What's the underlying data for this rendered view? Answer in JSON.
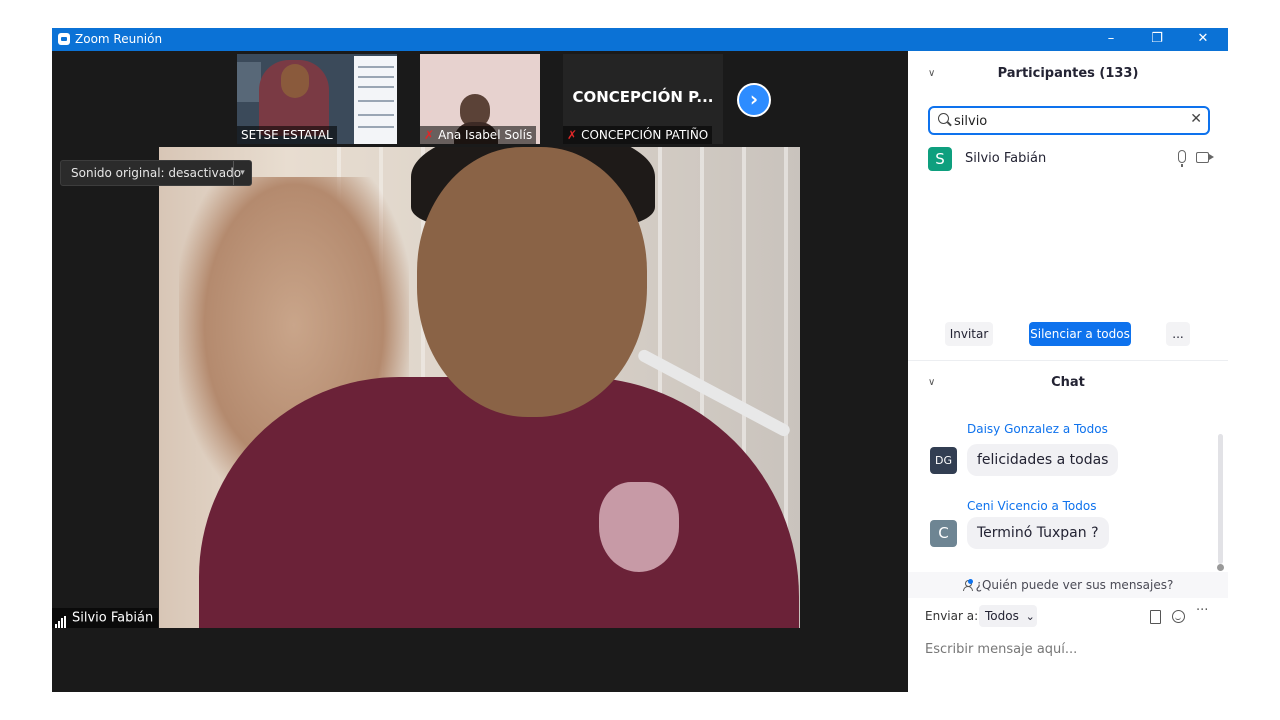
{
  "window": {
    "title": "Zoom Reunión",
    "minimize": "–",
    "restore": "❐",
    "close": "✕"
  },
  "thumbnails": [
    {
      "label": "SETSE ESTATAL",
      "muted": false
    },
    {
      "label": "Ana  Isabel Solís",
      "muted": true
    },
    {
      "label": "CONCEPCIÓN PATIÑO",
      "muted": true,
      "display_name": "CONCEPCIÓN  P..."
    }
  ],
  "next_arrow": "›",
  "audio_pill": {
    "label": "Sonido original: desactivado",
    "caret": "▾"
  },
  "speaker": {
    "name": "Silvio Fabián"
  },
  "participants": {
    "collapse": "∨",
    "title": "Participantes (133)",
    "search_value": "silvio",
    "clear": "✕",
    "items": [
      {
        "initial": "S",
        "name": "Silvio Fabián"
      }
    ],
    "buttons": {
      "invite": "Invitar",
      "mute_all": "Silenciar a todos",
      "more": "..."
    }
  },
  "chat": {
    "collapse": "∨",
    "title": "Chat",
    "messages": [
      {
        "initials": "DG",
        "sender": "Daisy Gonzalez a Todos",
        "text": "felicidades a todas"
      },
      {
        "initials": "C",
        "sender": "Ceni Vicencio a Todos",
        "text": "Terminó Tuxpan ?"
      }
    ],
    "privacy": "¿Quién puede ver sus mensajes?",
    "send_to_label": "Enviar a:",
    "send_to_value": "Todos",
    "send_to_caret": "⌄",
    "more": "···",
    "input_placeholder": "Escribir mensaje aquí..."
  },
  "colors": {
    "accent": "#0e72ed",
    "titlebar": "#0b72d6",
    "mute_red": "#e02828"
  }
}
